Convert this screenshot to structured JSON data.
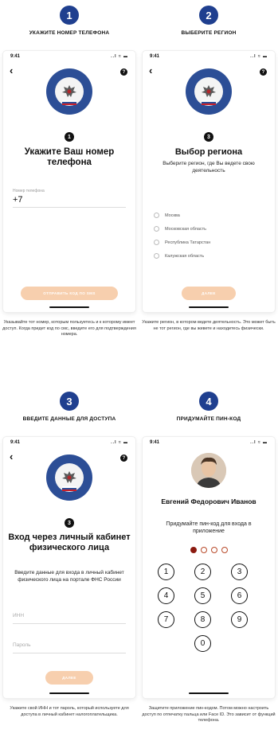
{
  "status_time": "9:41",
  "status_icons": "..l ≈ ▬",
  "help_icon": "?",
  "back_icon": "‹",
  "steps": [
    {
      "number": "1",
      "title": "Укажите номер телефона",
      "screen_step": "1",
      "heading": "Укажите Ваш номер телефона",
      "field_label": "Номер телефона",
      "field_value": "+7",
      "button": "Отправить код по SMS",
      "caption": "Указывайте тот номер, которым пользуетесь и к которому имеет доступ. Когда придет код по смс, введите его для подтверждения номера."
    },
    {
      "number": "2",
      "title": "Выберите регион",
      "screen_step": "3",
      "heading": "Выбор региона",
      "subtitle": "Выберите регион, где Вы ведете свою деятельность",
      "regions": [
        "Москва",
        "Московская область",
        "Республика Татарстан",
        "Калужская область"
      ],
      "button": "Далее",
      "caption": "Укажите регион, в котором ведете деятельность. Это может быть не тот регион, где вы живете и находитесь физически."
    },
    {
      "number": "3",
      "title": "Введите данные для доступа",
      "screen_step": "3",
      "heading": "Вход через личный кабинет физического лица",
      "subtitle": "Введите данные для входа в личный кабинет физического лица на портале ФНС России",
      "inn_placeholder": "ИНН",
      "password_placeholder": "Пароль",
      "button": "Далее",
      "caption": "Укажите свой ИНН и тот пароль, который используете для доступа в личный кабинет налогоплательщика."
    },
    {
      "number": "4",
      "title": "Придумайте пин-код",
      "user_name": "Евгений Федорович Иванов",
      "subtitle": "Придумайте пин-код для входа в приложение",
      "pin_filled": 1,
      "pin_total": 4,
      "keys": [
        "1",
        "2",
        "3",
        "4",
        "5",
        "6",
        "7",
        "8",
        "9",
        "0"
      ],
      "caption": "Защитите приложение пин-кодом. Потом можно настроить доступ по отпечатку пальца или Face ID. Это зависит от функций телефона."
    }
  ],
  "colors": {
    "step_circle": "#1f3f8f",
    "button": "#f7cfae",
    "pin_filled": "#8b1a10",
    "emblem_blue": "#2c4e96"
  }
}
